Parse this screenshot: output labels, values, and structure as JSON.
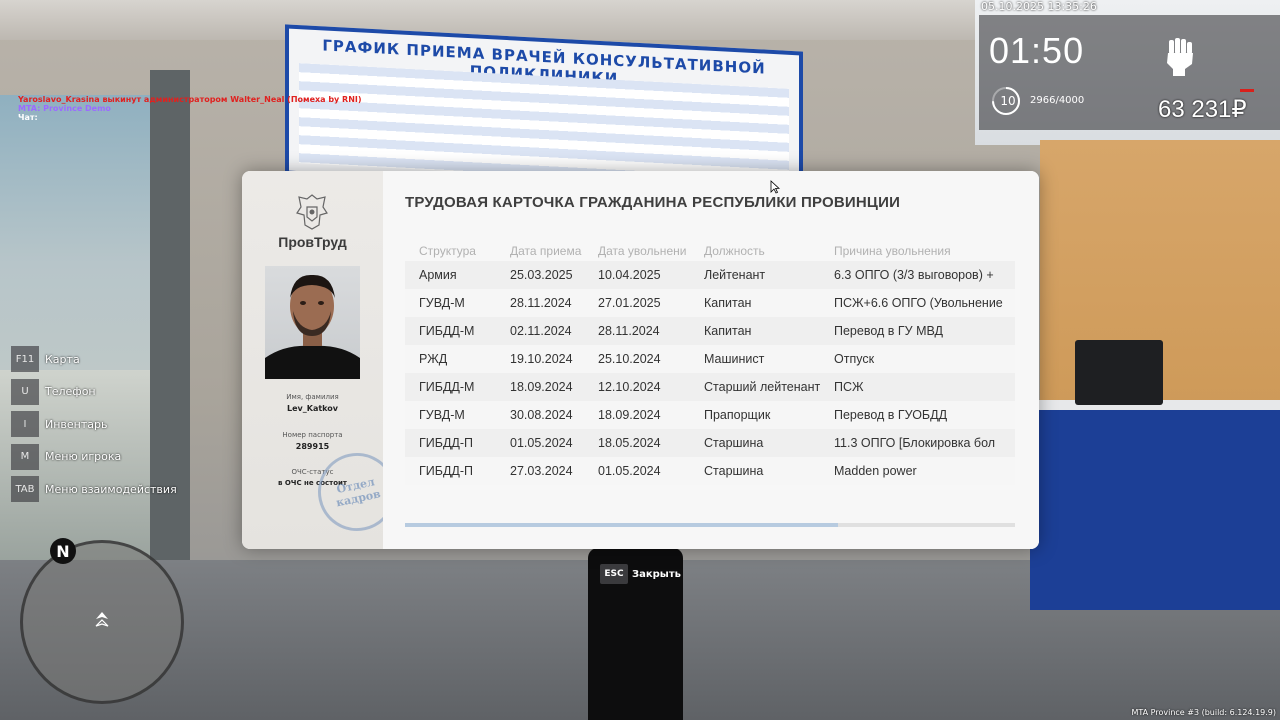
{
  "hud": {
    "datetime": "05.10.2025 13:35:26",
    "time": "01:50",
    "level": "10",
    "xp": "2966/4000",
    "xp_progress": 0.7415,
    "money": "63 231₽",
    "stamina_icon": "fist-icon"
  },
  "chat": {
    "line1": "Yaroslavo_Krasina выкинут администратором Walter_Neal (Помеха by RNI)",
    "line2": "MTA: Province Demo",
    "line3": "Чат:"
  },
  "hotkeys": [
    {
      "key": "F11",
      "label": "Карта"
    },
    {
      "key": "U",
      "label": "Телефон"
    },
    {
      "key": "I",
      "label": "Инвентарь"
    },
    {
      "key": "M",
      "label": "Меню игрока"
    },
    {
      "key": "TAB",
      "label": "Меню взаимодействия"
    }
  ],
  "minimap": {
    "north": "N"
  },
  "board": {
    "title": "ГРАФИК ПРИЕМА ВРАЧЕЙ КОНСУЛЬТАТИВНОЙ ПОЛИКЛИНИКИ"
  },
  "card": {
    "org_name": "ПровТруд",
    "title": "ТРУДОВАЯ КАРТОЧКА ГРАЖДАНИНА РЕСПУБЛИКИ ПРОВИНЦИИ",
    "name_label": "Имя, фамилия",
    "name_value": "Lev_Katkov",
    "passport_label": "Номер паспорта",
    "passport_value": "289915",
    "ochs_label": "ОЧС-статус",
    "ochs_value": "в ОЧС не состоит",
    "stamp_line1": "Отдел",
    "stamp_line2": "кадров",
    "columns": [
      "Структура",
      "Дата приема",
      "Дата увольнени",
      "Должность",
      "Причина увольнения"
    ],
    "rows": [
      [
        "Армия",
        "25.03.2025",
        "10.04.2025",
        "Лейтенант",
        "6.3 ОПГО (3/3 выговоров) +"
      ],
      [
        "ГУВД-М",
        "28.11.2024",
        "27.01.2025",
        "Капитан",
        "ПСЖ+6.6 ОПГО (Увольнение"
      ],
      [
        "ГИБДД-М",
        "02.11.2024",
        "28.11.2024",
        "Капитан",
        "Перевод в ГУ МВД"
      ],
      [
        "РЖД",
        "19.10.2024",
        "25.10.2024",
        "Машинист",
        "Отпуск"
      ],
      [
        "ГИБДД-М",
        "18.09.2024",
        "12.10.2024",
        "Старший лейтенант",
        "ПСЖ"
      ],
      [
        "ГУВД-М",
        "30.08.2024",
        "18.09.2024",
        "Прапорщик",
        "Перевод в ГУОБДД"
      ],
      [
        "ГИБДД-П",
        "01.05.2024",
        "18.05.2024",
        "Старшина",
        "11.3 ОПГО [Блокировка бол"
      ],
      [
        "ГИБДД-П",
        "27.03.2024",
        "01.05.2024",
        "Старшина",
        "Madden power"
      ]
    ]
  },
  "close_hint": {
    "key": "ESC",
    "label": "Закрыть"
  },
  "build": "MTA Province #3 (build: 6.124.19.9)"
}
